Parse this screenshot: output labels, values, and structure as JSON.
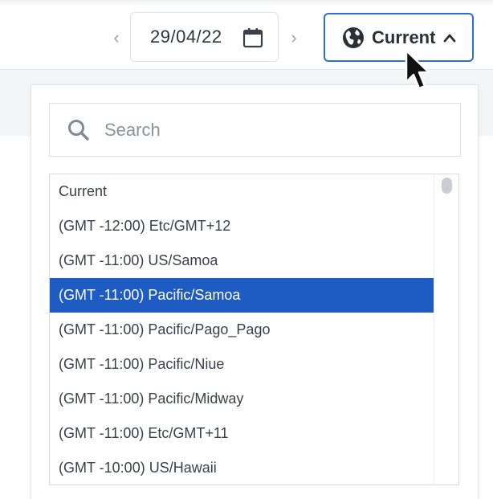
{
  "toolbar": {
    "prev_arrow": "‹",
    "next_arrow": "›",
    "date_value": "29/04/22",
    "timezone_button_label": "Current"
  },
  "dropdown": {
    "search": {
      "placeholder": "Search",
      "value": ""
    },
    "items": [
      "Current",
      "(GMT -12:00) Etc/GMT+12",
      "(GMT -11:00) US/Samoa",
      "(GMT -11:00) Pacific/Samoa",
      "(GMT -11:00) Pacific/Pago_Pago",
      "(GMT -11:00) Pacific/Niue",
      "(GMT -11:00) Pacific/Midway",
      "(GMT -11:00) Etc/GMT+11",
      "(GMT -10:00) US/Hawaii"
    ],
    "selected_index": 3
  },
  "colors": {
    "accent": "#2a6fd6",
    "selected_row": "#1e5cc4"
  },
  "icons": {
    "calendar": "calendar-icon",
    "globe": "globe-icon",
    "chevron": "chevron-up-icon",
    "search": "search-icon",
    "cursor": "cursor-icon"
  }
}
